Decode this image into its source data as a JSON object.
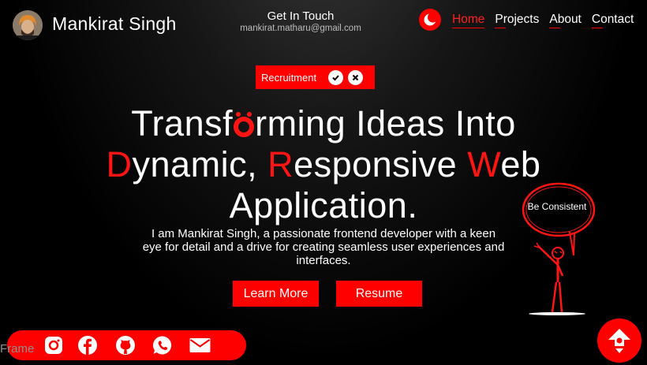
{
  "header": {
    "name": "Mankirat Singh",
    "contact_title": "Get In Touch",
    "contact_email": "mankirat.matharu@gmail.com",
    "nav": [
      {
        "label": "Home",
        "active": true
      },
      {
        "label": "Projects",
        "active": false
      },
      {
        "label": "About",
        "active": false
      },
      {
        "label": "Contact",
        "active": false
      }
    ]
  },
  "badge": {
    "label": "Recruitment"
  },
  "hero": {
    "title_line1_a": "Transf",
    "title_line1_b": "rming Ideas Into",
    "d": "D",
    "ynamic": "ynamic, ",
    "r": "R",
    "esponsive": "esponsive ",
    "w": "W",
    "eb": "eb",
    "title_line3": "Application.",
    "description": "I am Mankirat Singh, a passionate frontend developer with a keen eye for detail and a drive for creating seamless user experiences and interfaces."
  },
  "buttons": {
    "learn_more": "Learn More",
    "resume": "Resume"
  },
  "doodle": {
    "text": "Be Consistent"
  },
  "social": {
    "frame_label": "Frame",
    "icons": [
      "instagram-icon",
      "facebook-icon",
      "github-icon",
      "whatsapp-icon",
      "mail-icon"
    ]
  },
  "colors": {
    "accent": "#ff0000",
    "background": "#000000",
    "text": "#ffffff"
  }
}
